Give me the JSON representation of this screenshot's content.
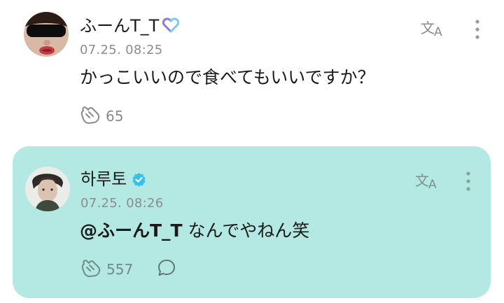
{
  "post": {
    "username": "ふーんT_T",
    "timestamp": "07.25. 08:25",
    "text": "かっこいいので食べてもいいですか？",
    "like_count": "65",
    "icons": {
      "badge": "heart-badge-icon",
      "translate": "translate-icon",
      "more": "more-vertical-icon",
      "like": "like-icon"
    }
  },
  "reply": {
    "username": "하루토",
    "timestamp": "07.25. 08:26",
    "mention": "@ふーんT_T",
    "text": " なんでやねん笑",
    "like_count": "557",
    "icons": {
      "badge": "verified-badge-icon",
      "translate": "translate-icon",
      "more": "more-vertical-icon",
      "like": "like-icon",
      "comment": "comment-icon"
    }
  },
  "colors": {
    "reply_background": "#b3e9e2",
    "muted_text": "#8c8c8c",
    "verified_badge": "#36c1e8",
    "heart_badge_left": "#8a7bd8",
    "heart_badge_right": "#7ec9f0"
  }
}
